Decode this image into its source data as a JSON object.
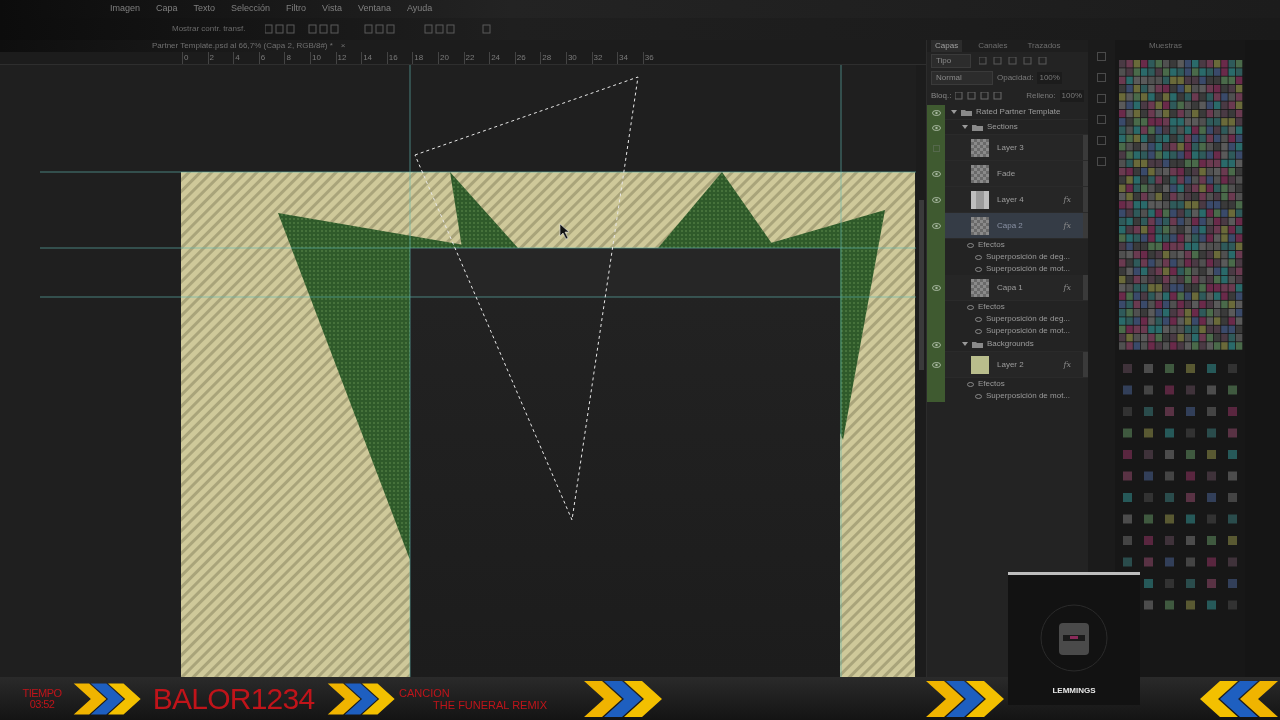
{
  "menu_bar": {
    "items": [
      "Imagen",
      "Capa",
      "Texto",
      "Selección",
      "Filtro",
      "Vista",
      "Ventana",
      "Ayuda"
    ]
  },
  "options_bar": {
    "transform_label": "Mostrar contr. transf."
  },
  "document_tab": {
    "title": "Partner Template.psd al 66,7% (Capa 2, RGB/8#) *",
    "close": "×"
  },
  "ruler": {
    "ticks": [
      "0",
      "2",
      "4",
      "6",
      "8",
      "10",
      "12",
      "14",
      "16",
      "18",
      "20",
      "22",
      "24",
      "26",
      "28",
      "30",
      "32",
      "34",
      "36"
    ]
  },
  "layers_panel": {
    "tabs": [
      {
        "label": "Capas",
        "selected": true
      },
      {
        "label": "Canales",
        "selected": false
      },
      {
        "label": "Trazados",
        "selected": false
      }
    ],
    "filter": "Tipo",
    "blend_mode": "Normal",
    "opacity_label": "Opacidad:",
    "opacity": "100%",
    "lock_label": "Bloq.:",
    "fill_label": "Relleno:",
    "fill": "100%",
    "layers": [
      {
        "kind": "group",
        "name": "Rated Partner Template",
        "visible": true,
        "expanded": true,
        "children": [
          {
            "kind": "group",
            "name": "Sections",
            "visible": true,
            "expanded": true,
            "children": [
              {
                "kind": "layer",
                "name": "Layer 3",
                "visible": false,
                "selected": false,
                "thumbnail": {
                  "kind": "transparent"
                }
              },
              {
                "kind": "layer",
                "name": "Fade",
                "visible": true,
                "selected": false,
                "thumbnail": {
                  "kind": "transparent"
                }
              },
              {
                "kind": "layer",
                "name": "Layer 4",
                "visible": true,
                "selected": false,
                "fx": "fx",
                "thumbnail": {
                  "kind": "dark"
                }
              },
              {
                "kind": "layer",
                "name": "Capa 2",
                "visible": true,
                "selected": true,
                "fx": "fx",
                "thumbnail": {
                  "kind": "transparent"
                },
                "effects": {
                  "title": "Efectos",
                  "items": [
                    "Superposición de deg...",
                    "Superposición de mot..."
                  ]
                }
              },
              {
                "kind": "layer",
                "name": "Capa 1",
                "visible": true,
                "selected": false,
                "fx": "fx",
                "thumbnail": {
                  "kind": "transparent"
                },
                "effects": {
                  "title": "Efectos",
                  "items": [
                    "Superposición de deg...",
                    "Superposición de mot..."
                  ]
                }
              }
            ]
          },
          {
            "kind": "group",
            "name": "Backgrounds",
            "visible": true,
            "expanded": true,
            "children": [
              {
                "kind": "layer",
                "name": "Layer 2",
                "visible": true,
                "selected": false,
                "fx": "fx",
                "thumbnail": {
                  "kind": "beige"
                },
                "effects": {
                  "title": "Efectos",
                  "items": [
                    "Superposición de mot..."
                  ]
                }
              }
            ]
          }
        ]
      }
    ]
  },
  "swatches_panel": {
    "tab": "Muestras"
  },
  "overlay": {
    "time_label": "TIEMPO",
    "time": "03:52",
    "channel": "BALOR1234",
    "song_label": "CANCION",
    "song": "THE FUNERAL REMIX",
    "album": "LEMMINGS"
  }
}
